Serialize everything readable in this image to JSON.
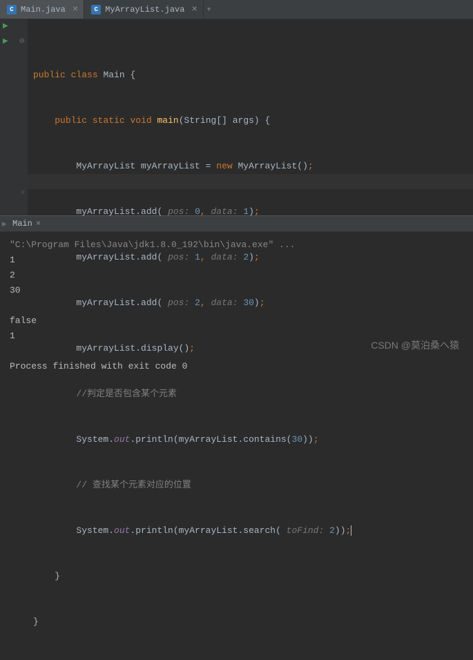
{
  "tabs": {
    "active": {
      "label": "Main.java",
      "icon": "C"
    },
    "inactive": {
      "label": "MyArrayList.java",
      "icon": "C"
    }
  },
  "code": {
    "l1": {
      "kw1": "public",
      "kw2": "class",
      "name": "Main",
      "brace": " {"
    },
    "l2": {
      "kw1": "public",
      "kw2": "static",
      "kw3": "void",
      "method": "main",
      "params": "(String[] args) {"
    },
    "l3": {
      "t1": "MyArrayList myArrayList = ",
      "kw": "new",
      "t2": " MyArrayList()",
      "semi": ";"
    },
    "l4": {
      "obj": "myArrayList.",
      "m": "add",
      "open": "(",
      "h1": " pos: ",
      "n1": "0",
      "c1": ",",
      "h2": " data: ",
      "n2": "1",
      "close": ")",
      "semi": ";"
    },
    "l5": {
      "obj": "myArrayList.",
      "m": "add",
      "open": "(",
      "h1": " pos: ",
      "n1": "1",
      "c1": ",",
      "h2": " data: ",
      "n2": "2",
      "close": ")",
      "semi": ";"
    },
    "l6": {
      "obj": "myArrayList.",
      "m": "add",
      "open": "(",
      "h1": " pos: ",
      "n1": "2",
      "c1": ",",
      "h2": " data: ",
      "n2": "30",
      "close": ")",
      "semi": ";"
    },
    "l7": {
      "obj": "myArrayList.",
      "m": "display",
      "p": "()",
      "semi": ";"
    },
    "l8": {
      "c": "//判定是否包含某个元素"
    },
    "l9": {
      "sys": "System.",
      "out": "out",
      "p": ".println(myArrayList.contains(",
      "n": "30",
      "close": "))",
      "semi": ";"
    },
    "l10": {
      "c": "// 查找某个元素对应的位置"
    },
    "l11": {
      "sys": "System.",
      "out": "out",
      "p": ".println(myArrayList.search(",
      "h": " toFind: ",
      "n": "2",
      "close": "))",
      "semi": ";"
    },
    "l12": {
      "b": "}"
    },
    "l13": {
      "b": "}"
    }
  },
  "console": {
    "tab": "Main",
    "cmd": "\"C:\\Program Files\\Java\\jdk1.8.0_192\\bin\\java.exe\" ...",
    "out1": "1",
    "out2": "2",
    "out3": "30",
    "blank": "",
    "out4": "false",
    "out5": "1",
    "exit": "Process finished with exit code 0"
  },
  "watermark": "CSDN @莫泊桑へ猿"
}
